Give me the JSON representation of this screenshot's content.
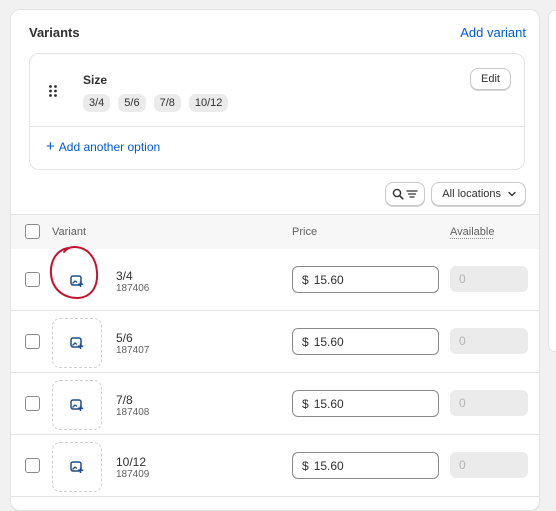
{
  "card": {
    "title": "Variants",
    "add_variant_label": "Add variant"
  },
  "option": {
    "name": "Size",
    "values": [
      "3/4",
      "5/6",
      "7/8",
      "10/12"
    ],
    "edit_label": "Edit",
    "add_option_label": "Add another option"
  },
  "toolbar": {
    "locations_label": "All locations"
  },
  "table": {
    "headers": {
      "variant": "Variant",
      "price": "Price",
      "available": "Available"
    },
    "rows": [
      {
        "name": "3/4",
        "sku": "187406",
        "currency": "$",
        "price": "15.60",
        "available_placeholder": "0"
      },
      {
        "name": "5/6",
        "sku": "187407",
        "currency": "$",
        "price": "15.60",
        "available_placeholder": "0"
      },
      {
        "name": "7/8",
        "sku": "187408",
        "currency": "$",
        "price": "15.60",
        "available_placeholder": "0"
      },
      {
        "name": "10/12",
        "sku": "187409",
        "currency": "$",
        "price": "15.60",
        "available_placeholder": "0"
      }
    ]
  },
  "icons": {
    "drag": "drag-handle-icon",
    "add_image": "image-add-icon",
    "search": "search-icon",
    "filter": "filter-icon",
    "chevron": "chevron-down-icon"
  },
  "colors": {
    "link": "#005bd3",
    "annotation": "#c8102e",
    "icon_blue": "#1f4e8c"
  }
}
